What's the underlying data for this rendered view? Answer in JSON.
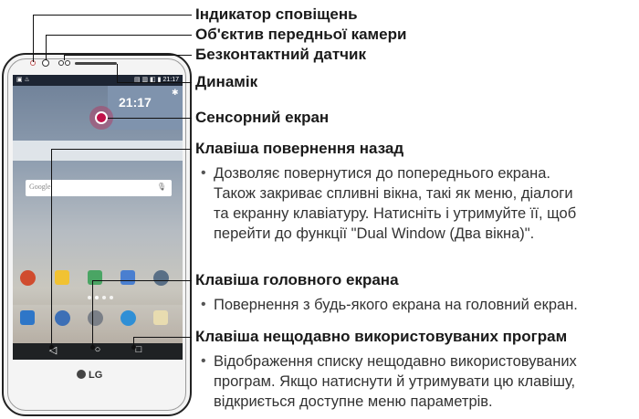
{
  "labels": {
    "notification_led": "Індикатор сповіщень",
    "front_camera": "Об'єктив передньої камери",
    "proximity_sensor": "Безконтактний датчик",
    "speaker": "Динамік",
    "touch_screen": "Сенсорний екран",
    "back_key": "Клавіша повернення назад",
    "home_key": "Клавіша головного екрана",
    "recent_key": "Клавіша нещодавно використовуваних програм"
  },
  "descriptions": {
    "back_lines": [
      "Дозволяє повернутися до попереднього екрана.",
      "Також закриває спливні вікна, такі як меню, діалоги",
      "та екранну клавіатуру. Натисніть і утримуйте її, щоб",
      "перейти до функції \"Dual Window (Два вікна)\"."
    ],
    "home_lines": [
      "Повернення з будь-якого екрана на головний екран."
    ],
    "recent_lines": [
      "Відображення списку нещодавно використовуваних",
      "програм. Якщо натиснути й утримувати цю клавішу,",
      "відкриється доступне меню параметрів."
    ]
  },
  "phone": {
    "clock": "21:17",
    "status_time": "21:17",
    "search_placeholder": "Google",
    "brand": "LG"
  },
  "colors": {
    "touch_accent": "#c1124a",
    "text": "#1a1a1a"
  },
  "icons": [
    "back-icon",
    "home-icon",
    "recent-icon",
    "mic-icon",
    "settings-icon"
  ]
}
